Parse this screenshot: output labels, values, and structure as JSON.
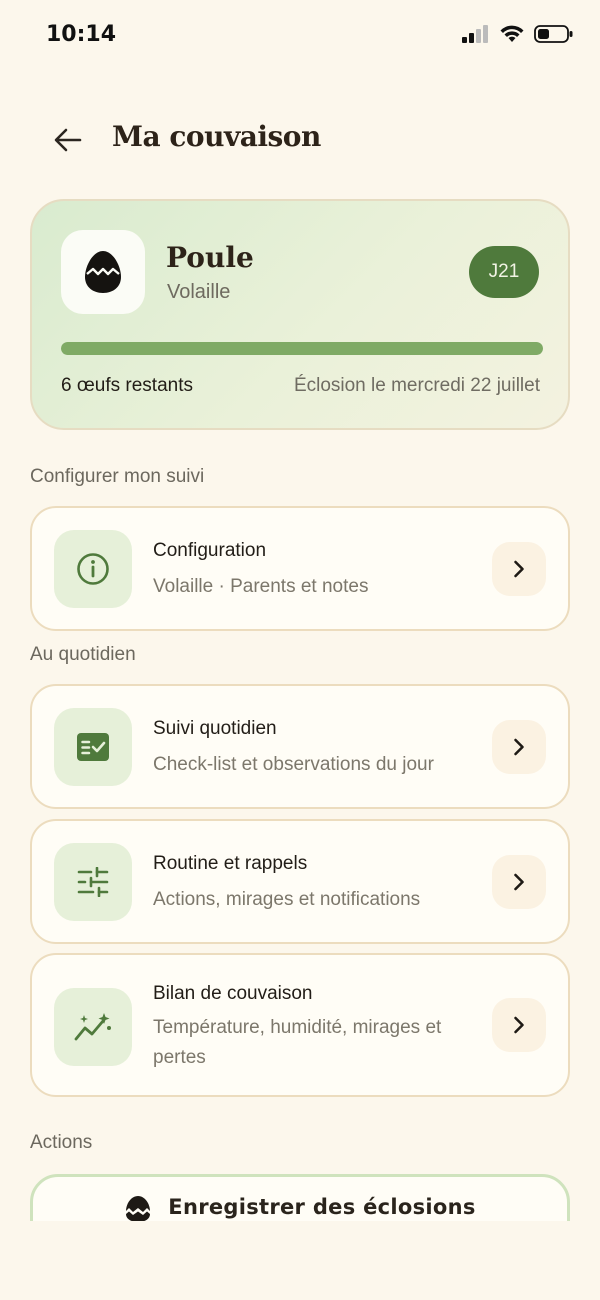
{
  "status_bar": {
    "time": "10:14"
  },
  "header": {
    "title": "Ma couvaison",
    "back_icon": "arrow-left-icon"
  },
  "hero": {
    "name": "Poule",
    "type": "Volaille",
    "day_badge": "J21",
    "progress_percent": 100,
    "eggs_remaining": "6 œufs restants",
    "hatch_date": "Éclosion le mercredi 22 juillet",
    "icon": "egg-icon"
  },
  "sections": {
    "configure": "Configurer mon suivi",
    "daily": "Au quotidien",
    "actions": "Actions"
  },
  "menu": [
    {
      "title": "Configuration",
      "subtitle": "Volaille · Parents et notes",
      "icon": "info-icon"
    },
    {
      "title": "Suivi quotidien",
      "subtitle": "Check-list et observations du jour",
      "icon": "checklist-icon"
    },
    {
      "title": "Routine et rappels",
      "subtitle": "Actions, mirages et notifications",
      "icon": "sliders-icon"
    },
    {
      "title": "Bilan de couvaison",
      "subtitle": "Température, humidité, mirages et pertes",
      "icon": "chart-sparkle-icon"
    }
  ],
  "action": {
    "label": "Enregistrer des éclosions",
    "icon": "hatched-egg-icon"
  },
  "colors": {
    "background": "#fcf7ec",
    "accent": "#4f7a3c",
    "progress": "#7faa65"
  }
}
